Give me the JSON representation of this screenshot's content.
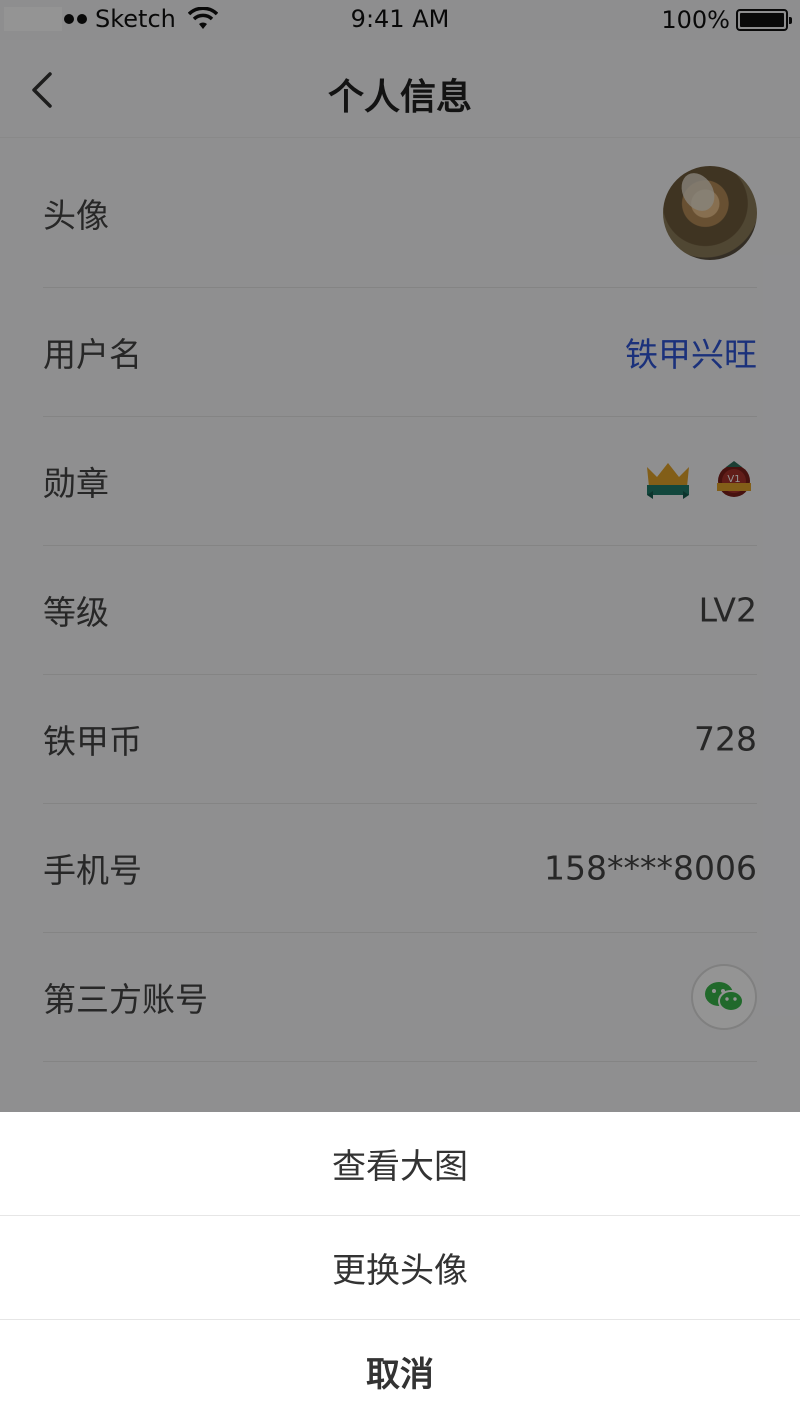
{
  "status_bar": {
    "carrier": "Sketch",
    "time": "9:41 AM",
    "battery": "100%"
  },
  "nav": {
    "title": "个人信息"
  },
  "rows": [
    {
      "label": "头像",
      "type": "avatar"
    },
    {
      "label": "用户名",
      "value": "铁甲兴旺"
    },
    {
      "label": "勋章",
      "type": "medals"
    },
    {
      "label": "等级",
      "value": "LV2"
    },
    {
      "label": "铁甲币",
      "value": "728"
    },
    {
      "label": "手机号",
      "value": "158****8006"
    },
    {
      "label": "第三方账号",
      "type": "wechat"
    }
  ],
  "action_sheet": {
    "view_large": "查看大图",
    "change_avatar": "更换头像",
    "cancel": "取消"
  },
  "colors": {
    "accent_blue": "#2f55d4",
    "wechat_green": "#3ab54a"
  }
}
